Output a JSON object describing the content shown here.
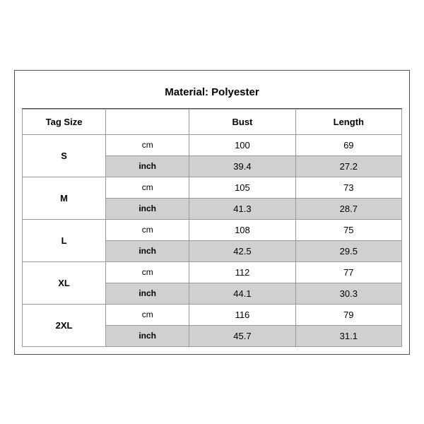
{
  "title": "Material: Polyester",
  "headers": {
    "tag_size": "Tag Size",
    "unit": "",
    "bust": "Bust",
    "length": "Length"
  },
  "rows": [
    {
      "size": "S",
      "cm": {
        "bust": "100",
        "length": "69"
      },
      "inch": {
        "bust": "39.4",
        "length": "27.2"
      }
    },
    {
      "size": "M",
      "cm": {
        "bust": "105",
        "length": "73"
      },
      "inch": {
        "bust": "41.3",
        "length": "28.7"
      }
    },
    {
      "size": "L",
      "cm": {
        "bust": "108",
        "length": "75"
      },
      "inch": {
        "bust": "42.5",
        "length": "29.5"
      }
    },
    {
      "size": "XL",
      "cm": {
        "bust": "112",
        "length": "77"
      },
      "inch": {
        "bust": "44.1",
        "length": "30.3"
      }
    },
    {
      "size": "2XL",
      "cm": {
        "bust": "116",
        "length": "79"
      },
      "inch": {
        "bust": "45.7",
        "length": "31.1"
      }
    }
  ],
  "units": {
    "cm": "cm",
    "inch": "inch"
  }
}
